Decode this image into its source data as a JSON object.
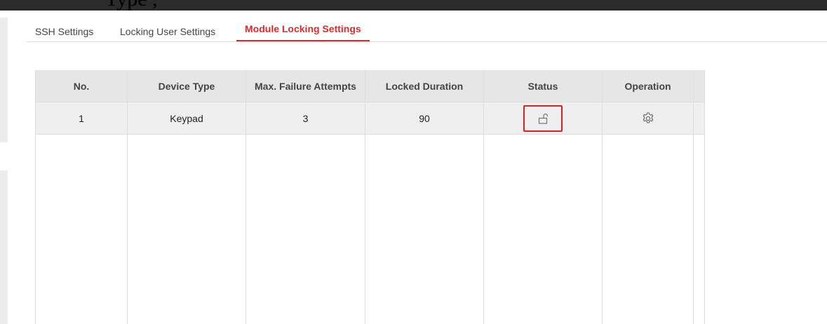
{
  "top_bar": {
    "fragment_text": "Type            ,"
  },
  "tabs": [
    {
      "label": "SSH Settings",
      "active": false
    },
    {
      "label": "Locking User Settings",
      "active": false
    },
    {
      "label": "Module Locking Settings",
      "active": true
    }
  ],
  "table": {
    "columns": [
      "No.",
      "Device Type",
      "Max. Failure Attempts",
      "Locked Duration",
      "Status",
      "Operation"
    ],
    "rows": [
      {
        "no": "1",
        "device_type": "Keypad",
        "max_failure_attempts": "3",
        "locked_duration": "90",
        "status_icon": "unlock-icon",
        "operation_icon": "gear-icon"
      }
    ]
  },
  "colors": {
    "accent": "#d92b2b",
    "highlight_box": "#e02020",
    "header_bg": "#e6e6e6",
    "row_bg": "#efefef",
    "top_bar": "#2b2b2b"
  }
}
